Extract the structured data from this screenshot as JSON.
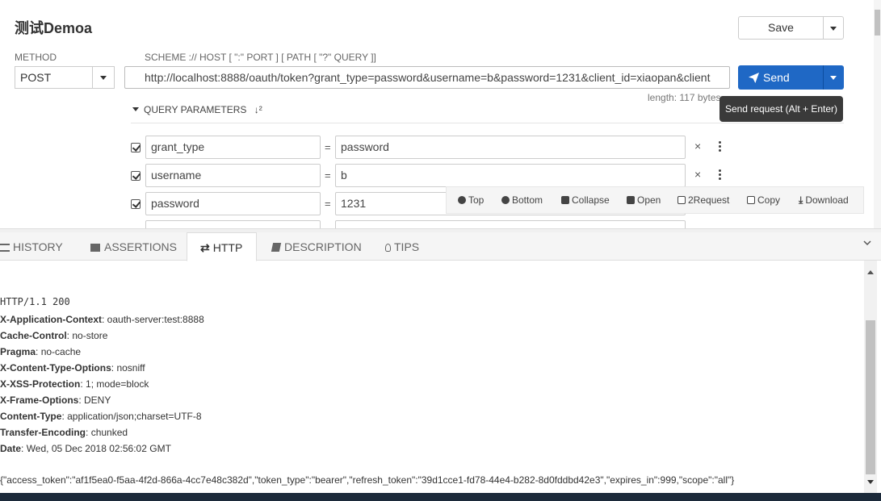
{
  "request": {
    "title": "测试Demoa",
    "save_label": "Save",
    "method_label": "METHOD",
    "method_value": "POST",
    "url_label": "SCHEME :// HOST [ \":\" PORT ] [ PATH [ \"?\" QUERY ]]",
    "url_value": "http://localhost:8888/oauth/token?grant_type=password&username=b&password=1231&client_id=xiaopan&client",
    "send_label": "Send",
    "length_text": "length: 117 bytes",
    "tooltip_text": "Send request (Alt + Enter)",
    "query_params_label": "QUERY PARAMETERS",
    "params": [
      {
        "name": "grant_type",
        "eq": "=",
        "value": "password"
      },
      {
        "name": "username",
        "eq": "=",
        "value": "b"
      },
      {
        "name": "password",
        "eq": "=",
        "value": "1231"
      }
    ]
  },
  "toolbar": {
    "top": "Top",
    "bottom": "Bottom",
    "collapse": "Collapse",
    "open": "Open",
    "to_request": "2Request",
    "copy": "Copy",
    "download": "Download"
  },
  "tabs": {
    "history": "HISTORY",
    "assertions": "ASSERTIONS",
    "http": "HTTP",
    "description": "DESCRIPTION",
    "tips": "TIPS"
  },
  "response": {
    "status_line": "HTTP/1.1 200",
    "headers": [
      {
        "name": "X-Application-Context",
        "value": "oauth-server:test:8888"
      },
      {
        "name": "Cache-Control",
        "value": "no-store"
      },
      {
        "name": "Pragma",
        "value": "no-cache"
      },
      {
        "name": "X-Content-Type-Options",
        "value": "nosniff"
      },
      {
        "name": "X-XSS-Protection",
        "value": "1; mode=block"
      },
      {
        "name": "X-Frame-Options",
        "value": "DENY"
      },
      {
        "name": "Content-Type",
        "value": "application/json;charset=UTF-8"
      },
      {
        "name": "Transfer-Encoding",
        "value": "chunked"
      },
      {
        "name": "Date",
        "value": "Wed, 05 Dec 2018 02:56:02 GMT"
      }
    ],
    "body": "{\"access_token\":\"af1f5ea0-f5aa-4f2d-866a-4cc7e48c382d\",\"token_type\":\"bearer\",\"refresh_token\":\"39d1cce1-fd78-44e4-b282-8d0fddbd42e3\",\"expires_in\":999,\"scope\":\"all\"}"
  },
  "colors": {
    "accent": "#1f68c5",
    "tooltip_bg": "#3a3a3a"
  }
}
